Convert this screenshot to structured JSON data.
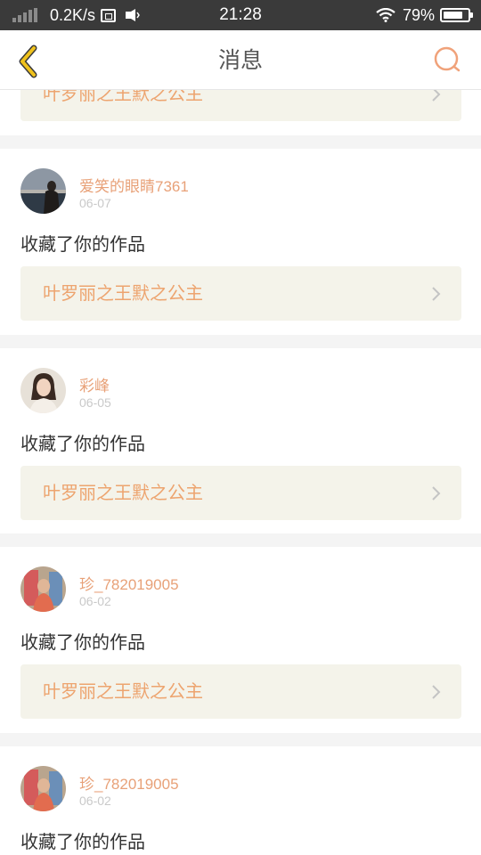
{
  "status_bar": {
    "net_speed": "0.2K/s",
    "time": "21:28",
    "battery": "79%",
    "battery_level": 0.79
  },
  "header": {
    "title": "消息",
    "back_icon": "chevron-left-icon",
    "search_icon": "search-icon"
  },
  "colors": {
    "accent": "#e8a178",
    "link_text": "#eda46f",
    "link_bg": "#f4f3ea",
    "back_chevron": "#f0c21c"
  },
  "notifications": [
    {
      "work_title": "叶罗丽之王默之公主"
    },
    {
      "user": "爱笑的眼睛7361",
      "date": "06-07",
      "action": "收藏了你的作品",
      "work_title": "叶罗丽之王默之公主"
    },
    {
      "user": "彩峰",
      "date": "06-05",
      "action": "收藏了你的作品",
      "work_title": "叶罗丽之王默之公主"
    },
    {
      "user": "珍_782019005",
      "date": "06-02",
      "action": "收藏了你的作品",
      "work_title": "叶罗丽之王默之公主"
    },
    {
      "user": "珍_782019005",
      "date": "06-02",
      "action": "收藏了你的作品"
    }
  ]
}
